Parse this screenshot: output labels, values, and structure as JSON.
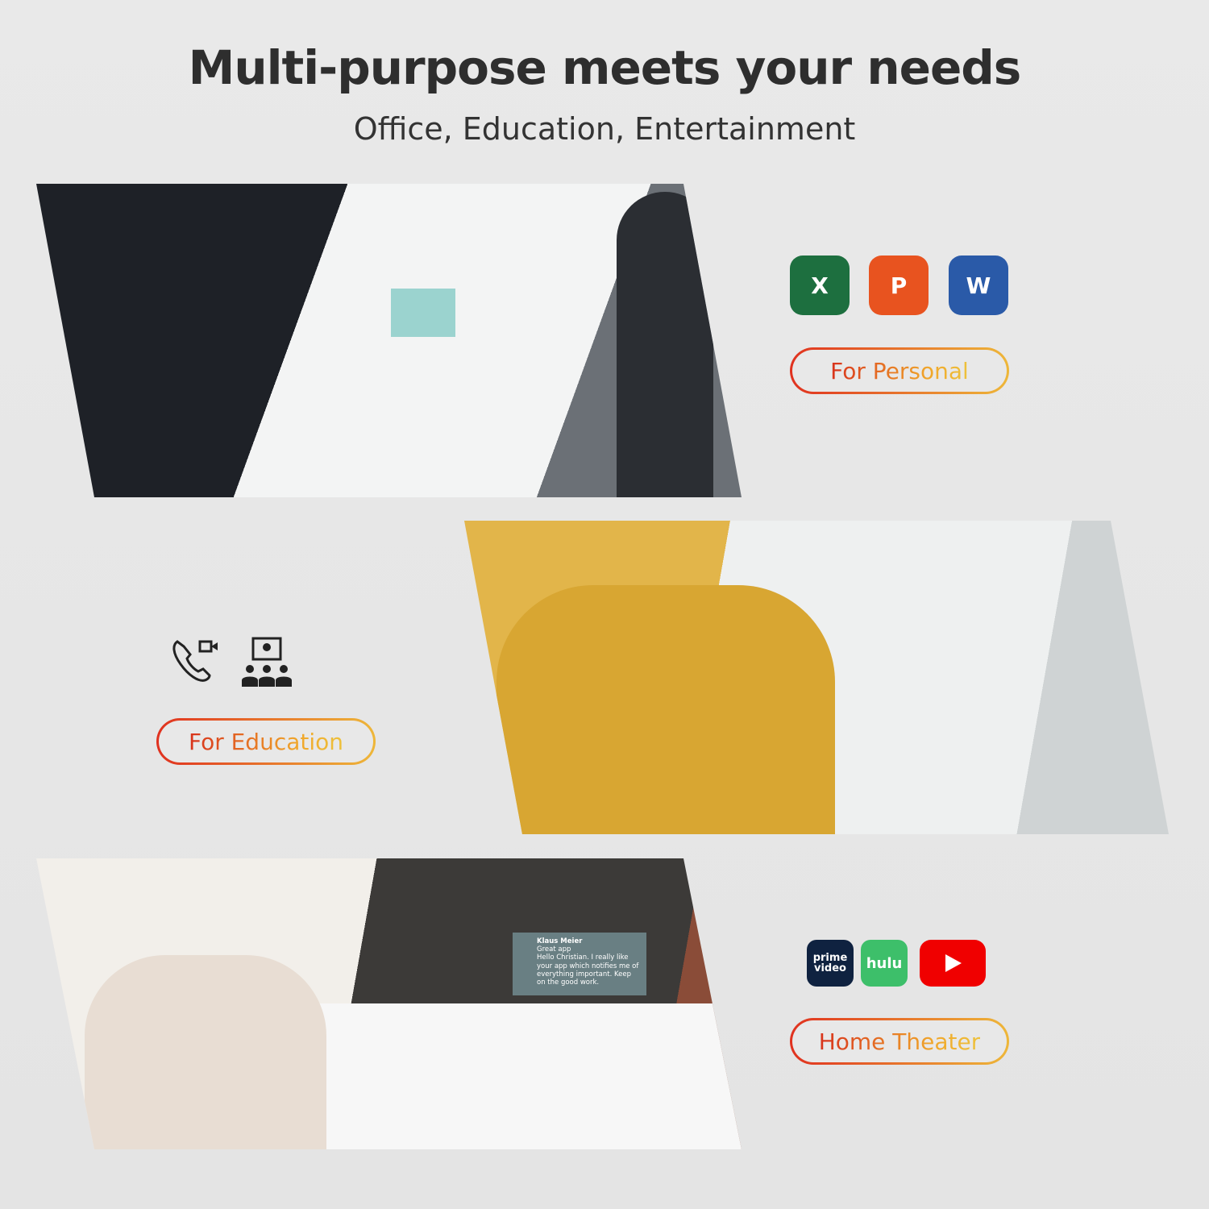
{
  "header": {
    "title": "Multi-purpose meets your needs",
    "subtitle": "Office, Education, Entertainment"
  },
  "sections": [
    {
      "label": "For Personal",
      "icons": [
        "excel-icon",
        "powerpoint-icon",
        "word-icon"
      ],
      "icon_letters": [
        "X",
        "P",
        "W"
      ],
      "icon_colors": [
        "#1d6f3f",
        "#e8531f",
        "#2a5aa8"
      ]
    },
    {
      "label": "For Education",
      "icons": [
        "video-call-icon",
        "online-class-icon"
      ]
    },
    {
      "label": "Home Theater",
      "icons": [
        "prime-video-icon",
        "hulu-icon",
        "youtube-icon"
      ],
      "icon_texts": [
        "prime video",
        "hulu"
      ],
      "icon_colors": [
        "#0f2240",
        "#3dbf6a",
        "#f00000"
      ]
    }
  ],
  "tv_notification": {
    "sender": "Klaus Meier",
    "subject": "Great app",
    "body": "Hello Christian. I really like your app which notifies me of everything important. Keep on the good work."
  },
  "accent_gradient": [
    "#e0311f",
    "#eeb739"
  ]
}
